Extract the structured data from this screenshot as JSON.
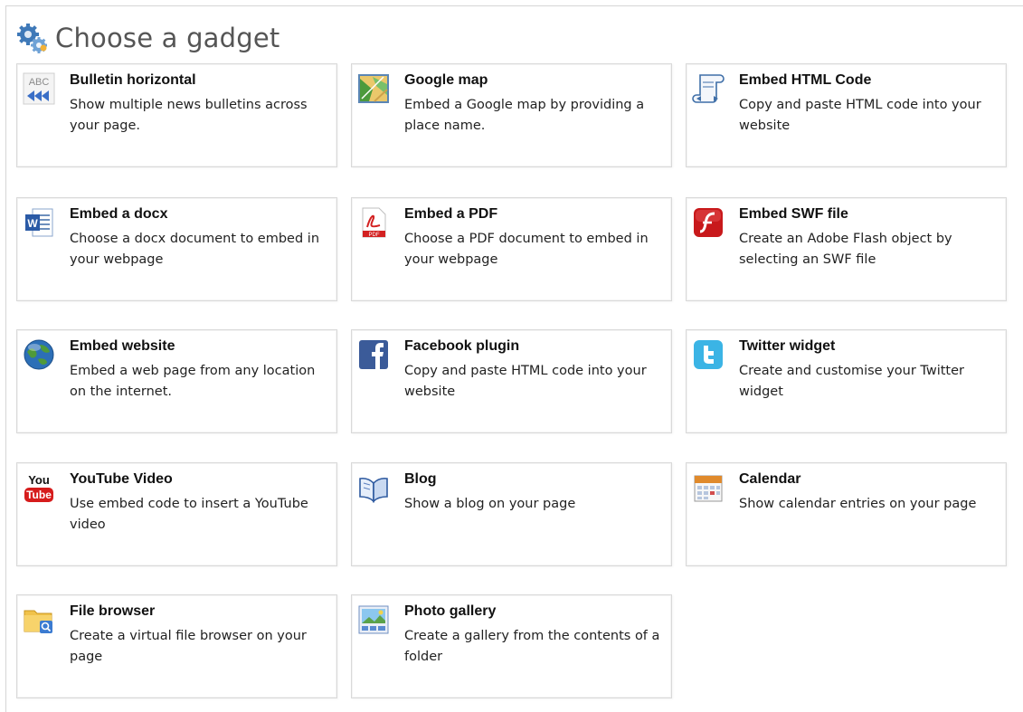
{
  "header": {
    "title": "Choose a gadget",
    "icon": "gears-icon"
  },
  "gadgets": [
    {
      "name": "Bulletin horizontal",
      "desc": "Show multiple news bulletins across your page.",
      "icon": "bulletin-icon"
    },
    {
      "name": "Google map",
      "desc": "Embed a Google map by providing a place name.",
      "icon": "map-icon"
    },
    {
      "name": "Embed HTML Code",
      "desc": "Copy and paste HTML code into your website",
      "icon": "scroll-code-icon"
    },
    {
      "name": "Embed a docx",
      "desc": "Choose a docx document to embed in your webpage",
      "icon": "word-doc-icon"
    },
    {
      "name": "Embed a PDF",
      "desc": "Choose a PDF document to embed in your webpage",
      "icon": "pdf-icon"
    },
    {
      "name": "Embed SWF file",
      "desc": "Create an Adobe Flash object by selecting an SWF file",
      "icon": "flash-icon"
    },
    {
      "name": "Embed website",
      "desc": "Embed a web page from any location on the internet.",
      "icon": "globe-icon"
    },
    {
      "name": "Facebook plugin",
      "desc": "Copy and paste HTML code into your website",
      "icon": "facebook-icon"
    },
    {
      "name": "Twitter widget",
      "desc": "Create and customise your Twitter widget",
      "icon": "twitter-icon"
    },
    {
      "name": "YouTube Video",
      "desc": "Use embed code to insert a YouTube video",
      "icon": "youtube-icon"
    },
    {
      "name": "Blog",
      "desc": "Show a blog on your page",
      "icon": "book-icon"
    },
    {
      "name": "Calendar",
      "desc": "Show calendar entries on your page",
      "icon": "calendar-icon"
    },
    {
      "name": "File browser",
      "desc": "Create a virtual file browser on your page",
      "icon": "folder-search-icon"
    },
    {
      "name": "Photo gallery",
      "desc": "Create a gallery from the contents of a folder",
      "icon": "photo-gallery-icon"
    }
  ]
}
